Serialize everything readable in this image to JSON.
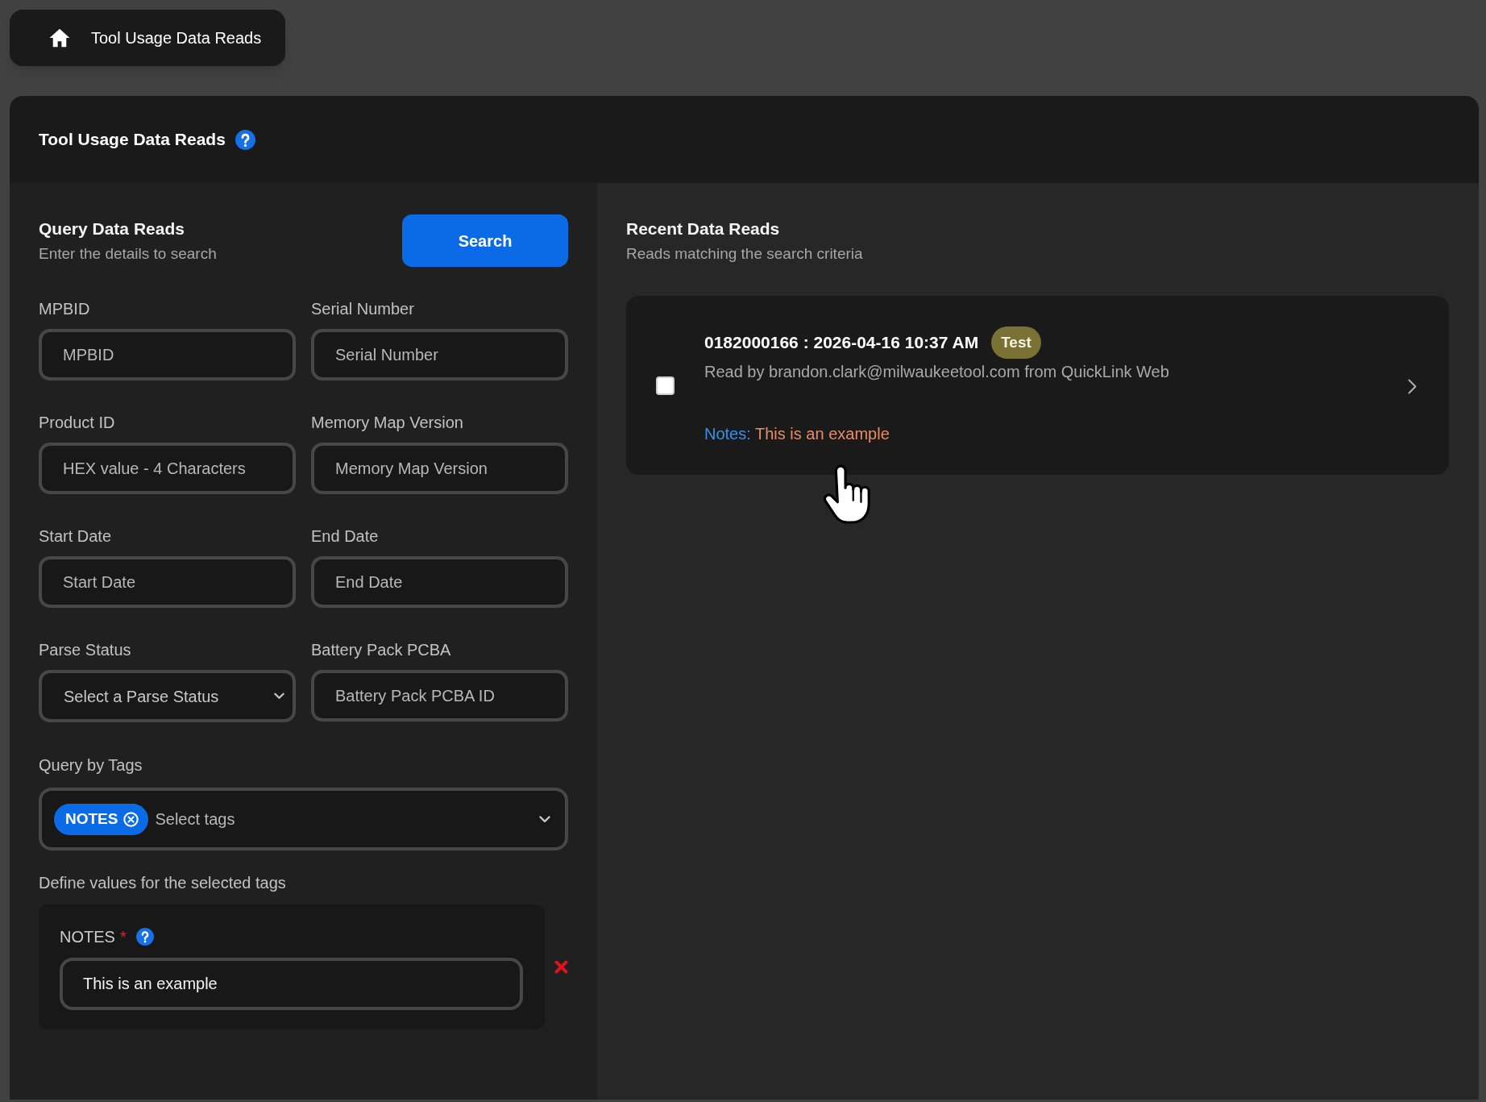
{
  "breadcrumb": {
    "title": "Tool Usage Data Reads"
  },
  "page_header": {
    "title": "Tool Usage Data Reads"
  },
  "query_panel": {
    "title": "Query Data Reads",
    "subtitle": "Enter the details to search",
    "search_button": "Search",
    "fields": [
      {
        "kind": "input",
        "label": "MPBID",
        "placeholder": "MPBID"
      },
      {
        "kind": "input",
        "label": "Serial Number",
        "placeholder": "Serial Number"
      },
      {
        "kind": "input",
        "label": "Product ID",
        "placeholder": "HEX value - 4 Characters"
      },
      {
        "kind": "input",
        "label": "Memory Map Version",
        "placeholder": "Memory Map Version"
      },
      {
        "kind": "input",
        "label": "Start Date",
        "placeholder": "Start Date"
      },
      {
        "kind": "input",
        "label": "End Date",
        "placeholder": "End Date"
      },
      {
        "kind": "select",
        "label": "Parse Status",
        "value": "Select a Parse Status"
      },
      {
        "kind": "input",
        "label": "Battery Pack PCBA",
        "placeholder": "Battery Pack PCBA ID"
      }
    ],
    "tags": {
      "label": "Query by Tags",
      "chips": [
        {
          "label": "NOTES"
        }
      ],
      "placeholder": "Select tags"
    },
    "tag_values": {
      "label": "Define values for the selected tags",
      "items": [
        {
          "label": "NOTES",
          "required_mark": "*",
          "value": "This is an example"
        }
      ]
    }
  },
  "results_panel": {
    "title": "Recent Data Reads",
    "subtitle": "Reads matching the search criteria",
    "reads": [
      {
        "checked": false,
        "title": "0182000166 : 2026-04-16 10:37 AM",
        "tags": [
          {
            "label": "Test",
            "color": "#7a7234"
          }
        ],
        "description": "Read by brandon.clark@milwaukeetool.com from QuickLink Web",
        "notes_label": "Notes:",
        "notes": "This is an example"
      }
    ]
  }
}
